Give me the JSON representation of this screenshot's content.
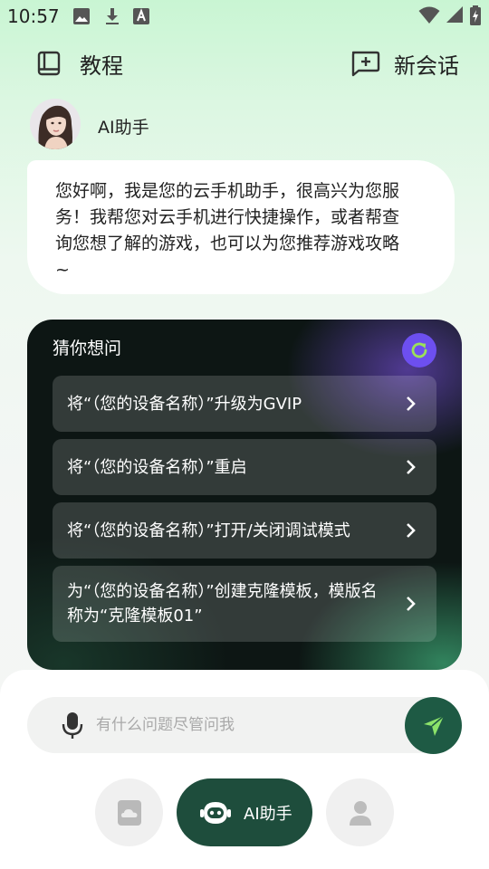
{
  "status_bar": {
    "time": "10:57",
    "left_icons": [
      "image-icon",
      "download-icon",
      "keyboard-a-icon"
    ],
    "right_icons": [
      "wifi-icon",
      "signal-icon",
      "battery-icon"
    ]
  },
  "header": {
    "tutorial_label": "教程",
    "new_chat_label": "新会话"
  },
  "assistant": {
    "name": "AI助手",
    "greeting_lines": [
      "您好啊，我是您的云手机助手，很高兴为您服",
      "务！我帮您对云手机进行快捷操作，或者帮查",
      "询您想了解的游戏，也可以为您推荐游戏攻略",
      "~"
    ]
  },
  "suggestions": {
    "title": "猜你想问",
    "items": [
      {
        "lines": [
          "将“（您的设备名称）”升级为GVIP"
        ]
      },
      {
        "lines": [
          "将“（您的设备名称）”重启"
        ]
      },
      {
        "lines": [
          "将“（您的设备名称）”打开/关闭调试模式"
        ]
      },
      {
        "lines": [
          "为“（您的设备名称）”创建克隆模板，模版名",
          "称为“克隆模板01”"
        ]
      }
    ]
  },
  "input": {
    "placeholder": "有什么问题尽管问我"
  },
  "bottom_nav": {
    "ai_label": "AI助手"
  },
  "colors": {
    "accent_dark_green": "#1e4d3c",
    "send_green": "#1e5a44",
    "refresh_purple": "#6d4ff0",
    "send_arrow_green": "#8ce36a"
  }
}
